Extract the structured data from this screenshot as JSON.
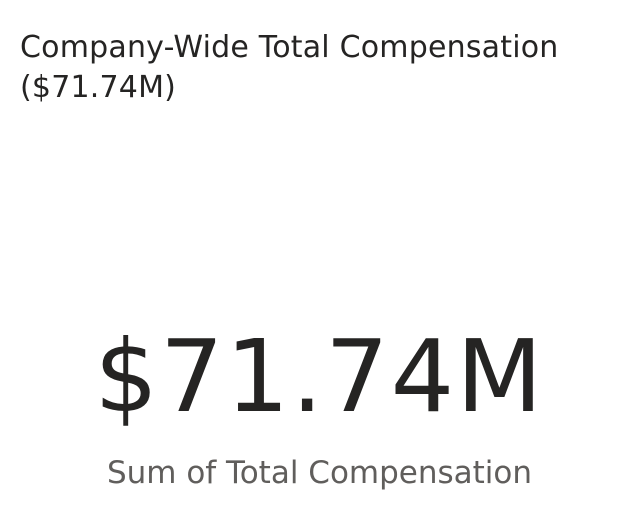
{
  "card": {
    "title": "Company-Wide Total Compensation ($71.74M)",
    "value": "$71.74M",
    "label": "Sum of Total Compensation"
  },
  "colors": {
    "text_primary": "#252423",
    "text_secondary": "#605e5c",
    "background": "#ffffff"
  }
}
